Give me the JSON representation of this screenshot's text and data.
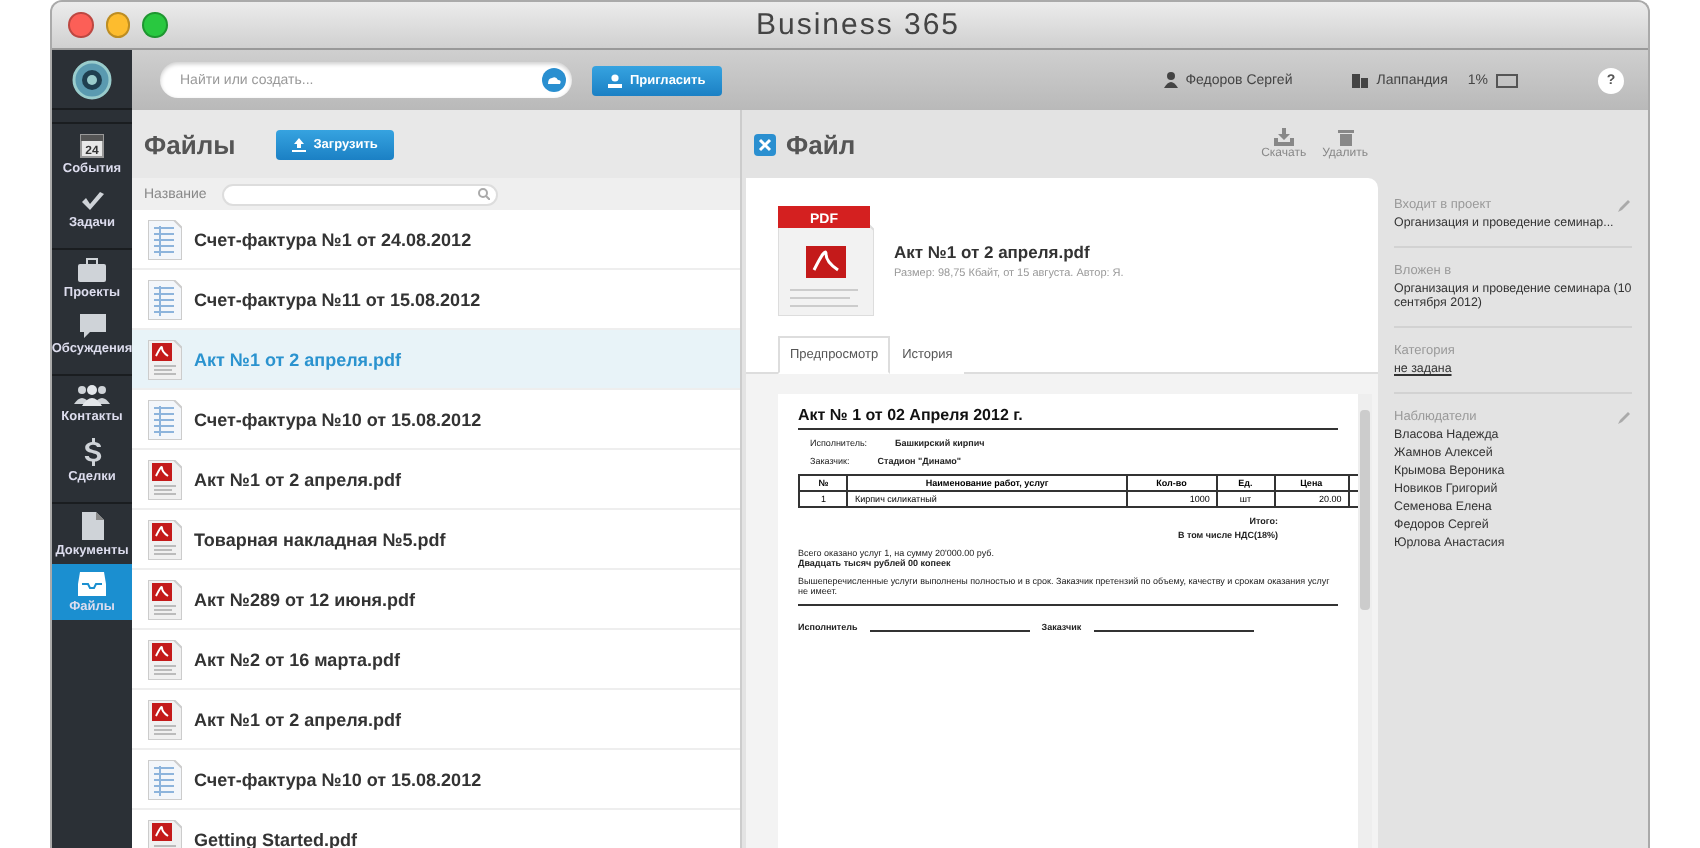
{
  "window": {
    "title": "Business 365"
  },
  "topbar": {
    "search": {
      "placeholder": "Найти или создать..."
    },
    "invite": "Пригласить",
    "user": "Федоров Сергей",
    "company": "Лаппандия",
    "storage": "1%",
    "help": "?"
  },
  "sidebar": {
    "items": [
      {
        "label": "События",
        "kind": "calendar",
        "day": "24",
        "selected": false,
        "group_start": true
      },
      {
        "label": "Задачи",
        "kind": "check",
        "selected": false,
        "group_start": false
      },
      {
        "label": "Проекты",
        "kind": "briefcase",
        "selected": false,
        "group_start": true
      },
      {
        "label": "Обсуждения",
        "kind": "chat",
        "selected": false,
        "group_start": false
      },
      {
        "label": "Контакты",
        "kind": "people",
        "selected": false,
        "group_start": true
      },
      {
        "label": "Сделки",
        "kind": "dollar",
        "selected": false,
        "group_start": false
      },
      {
        "label": "Документы",
        "kind": "document",
        "selected": false,
        "group_start": true
      },
      {
        "label": "Файлы",
        "kind": "inbox",
        "selected": true,
        "group_start": false
      }
    ]
  },
  "files": {
    "title": "Файлы",
    "upload": "Загрузить",
    "filter_label": "Название",
    "rows": [
      {
        "name": "Счет-фактура №1 от 24.08.2012",
        "kind": "invoice",
        "selected": false
      },
      {
        "name": "Счет-фактура №11 от 15.08.2012",
        "kind": "invoice",
        "selected": false
      },
      {
        "name": "Акт №1 от 2 апреля.pdf",
        "kind": "pdf",
        "selected": true
      },
      {
        "name": "Счет-фактура №10 от 15.08.2012",
        "kind": "invoice",
        "selected": false
      },
      {
        "name": "Акт №1 от 2 апреля.pdf",
        "kind": "pdf",
        "selected": false
      },
      {
        "name": "Товарная накладная №5.pdf",
        "kind": "pdf",
        "selected": false
      },
      {
        "name": "Акт №289 от 12 июня.pdf",
        "kind": "pdf",
        "selected": false
      },
      {
        "name": "Акт №2 от 16 марта.pdf",
        "kind": "pdf",
        "selected": false
      },
      {
        "name": "Акт №1 от 2 апреля.pdf",
        "kind": "pdf",
        "selected": false
      },
      {
        "name": "Счет-фактура №10 от 15.08.2012",
        "kind": "invoice",
        "selected": false
      },
      {
        "name": "Getting Started.pdf",
        "kind": "pdf",
        "selected": false
      }
    ]
  },
  "file_panel": {
    "title": "Файл",
    "actions": [
      {
        "label": "Скачать",
        "kind": "download"
      },
      {
        "label": "Удалить",
        "kind": "trash"
      }
    ],
    "file": {
      "badge": "PDF",
      "name": "Акт №1 от 2 апреля.pdf",
      "meta": "Размер: 98,75 Кбайт, от 15 августа. Автор: Я."
    },
    "tabs": [
      {
        "label": "Предпросмотр",
        "selected": true
      },
      {
        "label": "История",
        "selected": false
      }
    ],
    "preview": {
      "title": "Акт № 1 от 02 Апреля 2012 г.",
      "parties": [
        {
          "label": "Исполнитель:",
          "value": "Башкирский кирпич"
        },
        {
          "label": "Заказчик:",
          "value": "Стадион \"Динамо\""
        }
      ],
      "columns": [
        "№",
        "Наименование работ, услуг",
        "Кол-во",
        "Ед.",
        "Цена"
      ],
      "rows": [
        [
          "1",
          "Кирпич силикатный",
          "1000",
          "шт",
          "20.00"
        ]
      ],
      "totals": [
        "Итого:",
        "В том числе НДС(18%)"
      ],
      "sum_line": "Всего оказано услуг 1, на сумму 20'000.00 руб.",
      "sum_words": "Двадцать тысяч рублей 00 копеек",
      "note": "Вышеперечисленные услуги выполнены полностью и в срок. Заказчик претензий по объему, качеству и срокам оказания услуг не имеет.",
      "signatures": [
        "Исполнитель",
        "Заказчик"
      ]
    }
  },
  "info": {
    "sections": [
      {
        "label": "Входит в проект",
        "editable": true,
        "kind": "text",
        "values": [
          "Организация и проведение семинар..."
        ]
      },
      {
        "label": "Вложен в",
        "editable": false,
        "kind": "text",
        "values": [
          "Организация и проведение семинара (10 сентября 2012)"
        ]
      },
      {
        "label": "Категория",
        "editable": false,
        "kind": "link",
        "values": [
          "не задана"
        ]
      },
      {
        "label": "Наблюдатели",
        "editable": true,
        "kind": "list",
        "values": [
          "Власова Надежда",
          "Жамнов Алексей",
          "Крымова Вероника",
          "Новиков Григорий",
          "Семенова Елена",
          "Федоров Сергей",
          "Юрлова Анастасия"
        ]
      }
    ]
  }
}
